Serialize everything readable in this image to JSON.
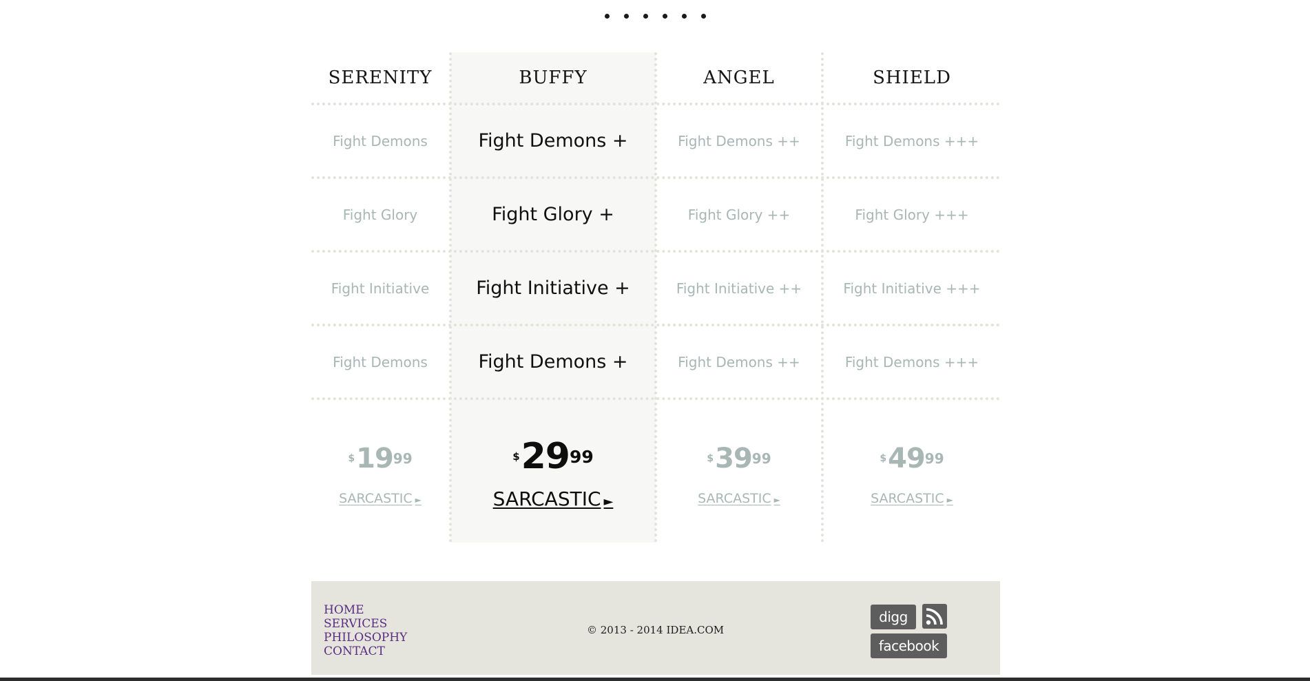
{
  "pricing": {
    "plans": [
      {
        "name": "SERENITY",
        "features": [
          "Fight Demons",
          "Fight Glory",
          "Fight Initiative",
          "Fight Demons"
        ],
        "price": {
          "currency": "$",
          "whole": "19",
          "cents": "99"
        },
        "cta": "SARCASTIC",
        "featured": false
      },
      {
        "name": "BUFFY",
        "features": [
          "Fight Demons +",
          "Fight Glory +",
          "Fight Initiative +",
          "Fight Demons +"
        ],
        "price": {
          "currency": "$",
          "whole": "29",
          "cents": "99"
        },
        "cta": "SARCASTIC",
        "featured": true
      },
      {
        "name": "ANGEL",
        "features": [
          "Fight Demons ++",
          "Fight Glory ++",
          "Fight Initiative ++",
          "Fight Demons ++"
        ],
        "price": {
          "currency": "$",
          "whole": "39",
          "cents": "99"
        },
        "cta": "SARCASTIC",
        "featured": false
      },
      {
        "name": "SHIELD",
        "features": [
          "Fight Demons +++",
          "Fight Glory +++",
          "Fight Initiative +++",
          "Fight Demons +++"
        ],
        "price": {
          "currency": "$",
          "whole": "49",
          "cents": "99"
        },
        "cta": "SARCASTIC",
        "featured": false
      }
    ],
    "cta_arrow": "►"
  },
  "footer": {
    "nav": [
      "HOME",
      "SERVICES",
      "PHILOSOPHY",
      "CONTACT"
    ],
    "copyright": "© 2013 - 2014 IDEA.COM",
    "social": {
      "digg": "digg",
      "facebook": "facebook"
    }
  },
  "icons": {
    "rss": "rss-icon",
    "dots": "pagination-dots"
  },
  "colors": {
    "nav_link": "#5a2d82",
    "muted_text": "#a8b7b4",
    "footer_bg": "#e5e5de",
    "featured_bg": "#f7f7f5",
    "social_badge": "#5d5d5d"
  }
}
